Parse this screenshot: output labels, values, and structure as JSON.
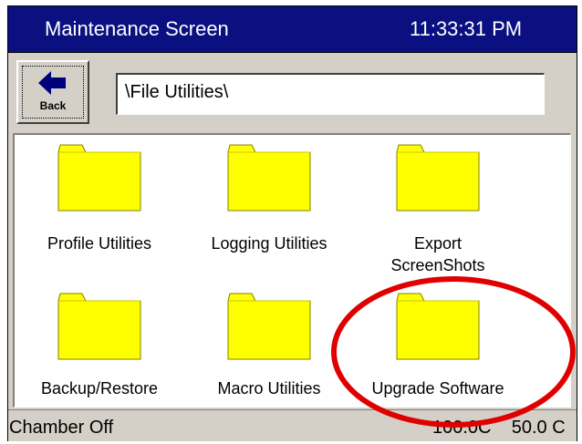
{
  "header": {
    "title": "Maintenance Screen",
    "time": "11:33:31 PM"
  },
  "toolbar": {
    "back_label": "Back",
    "path": "\\File Utilities\\"
  },
  "folders": [
    {
      "label": "Profile Utilities"
    },
    {
      "label": "Logging Utilities"
    },
    {
      "label": "Export\nScreenShots"
    },
    {
      "label": "Backup/Restore"
    },
    {
      "label": "Macro Utilities"
    },
    {
      "label": "Upgrade Software"
    }
  ],
  "status": {
    "state": "Chamber Off",
    "readings": "100.0C    50.0 C"
  },
  "colors": {
    "title_bar": "#0a1080",
    "folder": "#ffff00",
    "highlight_ring": "#e00000",
    "panel_bg": "#d4d0c8"
  }
}
